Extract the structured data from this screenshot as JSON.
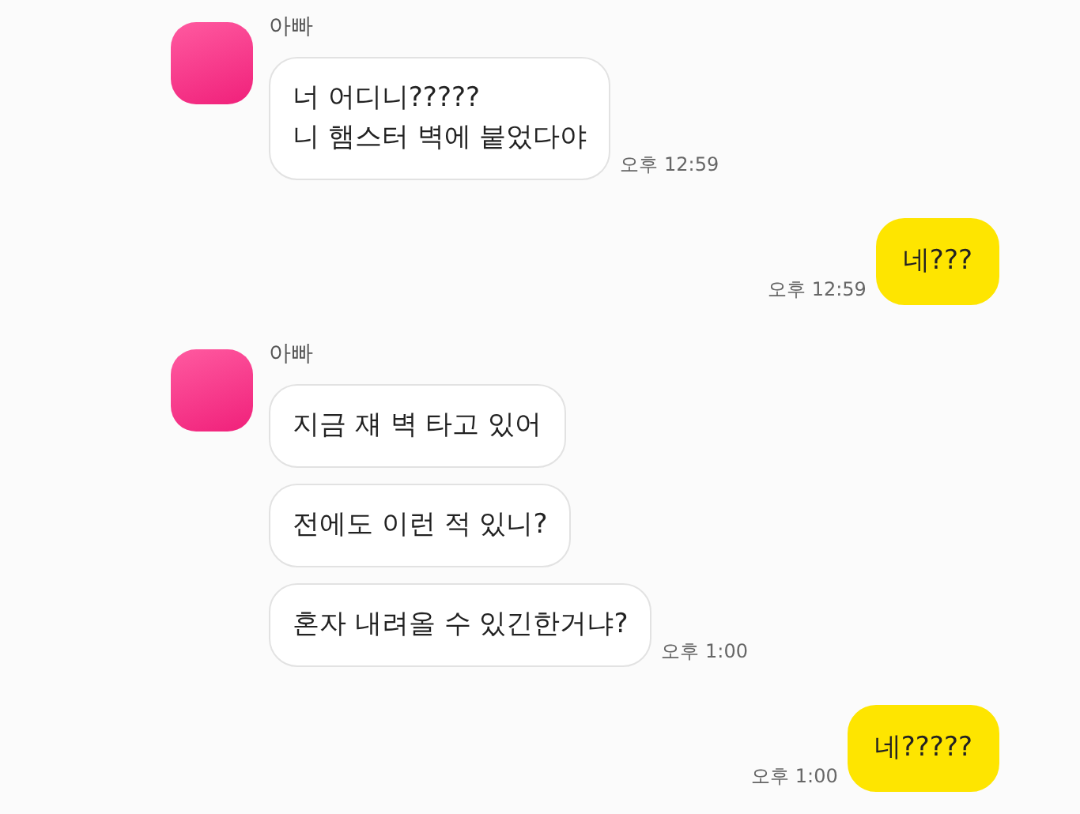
{
  "chat": [
    {
      "kind": "received",
      "sender": "아빠",
      "messages": [
        "너 어디니?????\n니 햄스터 벽에 붙었다야"
      ],
      "time": "오후 12:59"
    },
    {
      "kind": "sent",
      "messages": [
        "네???"
      ],
      "time": "오후 12:59"
    },
    {
      "kind": "received",
      "sender": "아빠",
      "messages": [
        "지금 쟤 벽 타고 있어",
        "전에도 이런 적 있니?",
        "혼자 내려올 수 있긴한거냐?"
      ],
      "time": "오후 1:00"
    },
    {
      "kind": "sent",
      "messages": [
        "네?????"
      ],
      "time": "오후 1:00"
    }
  ]
}
